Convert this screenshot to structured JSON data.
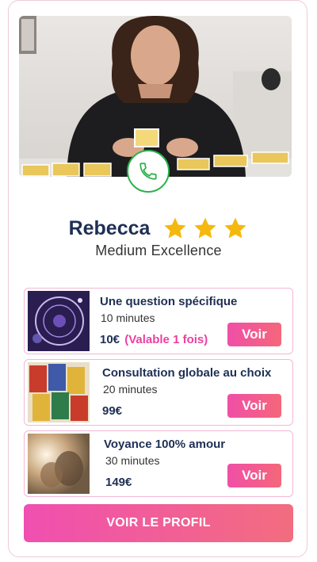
{
  "profile": {
    "name": "Rebecca",
    "stars": 3,
    "subtitle": "Medium Excellence",
    "photo_alt": "Rebecca",
    "call_icon": "phone-icon",
    "accent_green": "#2cb14a",
    "star_color": "#f5b80f"
  },
  "offers": [
    {
      "title": "Une question spécifique",
      "duration": "10 minutes",
      "price": "10€",
      "price_note": "(Valable 1 fois)",
      "button": "Voir",
      "thumb": "zodiac-wheel-image"
    },
    {
      "title": "Consultation globale au choix",
      "duration": "20 minutes",
      "price": "99€",
      "price_note": "",
      "button": "Voir",
      "thumb": "tarot-cards-image"
    },
    {
      "title": "Voyance 100% amour",
      "duration": "30 minutes",
      "price": "149€",
      "price_note": "",
      "button": "Voir",
      "thumb": "couple-image"
    }
  ],
  "cta": {
    "label": "VOIR LE PROFIL",
    "color_start": "#f04fb0",
    "color_end": "#f26d7f"
  }
}
